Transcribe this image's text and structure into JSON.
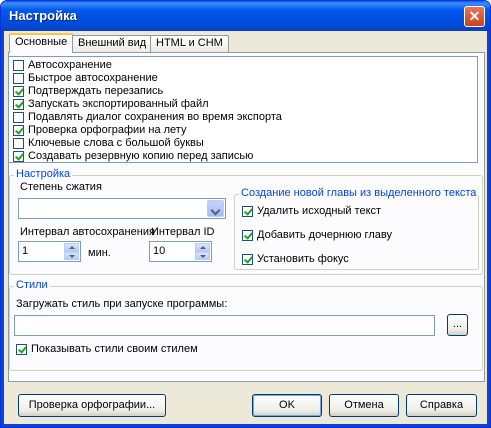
{
  "window": {
    "title": "Настройка",
    "close_glyph": "✕"
  },
  "tabs": [
    {
      "label": "Основные",
      "active": true
    },
    {
      "label": "Внешний вид",
      "active": false
    },
    {
      "label": "HTML и CHM",
      "active": false
    }
  ],
  "options_list": [
    {
      "label": "Автосохранение",
      "checked": false
    },
    {
      "label": "Быстрое автосохранение",
      "checked": false
    },
    {
      "label": "Подтверждать перезапись",
      "checked": true
    },
    {
      "label": "Запускать экспортированный файл",
      "checked": true
    },
    {
      "label": "Подавлять диалог сохранения во время экспорта",
      "checked": false
    },
    {
      "label": "Проверка орфографии на лету",
      "checked": true
    },
    {
      "label": "Ключевые слова с большой буквы",
      "checked": false
    },
    {
      "label": "Создавать резервную копию перед записью",
      "checked": true
    }
  ],
  "settings": {
    "group_title": "Настройка",
    "compression_label": "Степень сжатия",
    "compression_value": "",
    "autosave_interval_label": "Интервал автосохранения",
    "autosave_interval_value": "1",
    "autosave_unit": "мин.",
    "id_interval_label": "Интервал ID",
    "id_interval_value": "10"
  },
  "new_chapter": {
    "group_title": "Создание новой главы из выделенного текста",
    "options": [
      {
        "label": "Удалить исходный текст",
        "checked": true
      },
      {
        "label": "Добавить дочернюю главу",
        "checked": true
      },
      {
        "label": "Установить фокус",
        "checked": true
      }
    ]
  },
  "styles": {
    "group_title": "Стили",
    "load_label": "Загружать стиль при запуске программы:",
    "load_value": "",
    "browse_label": "...",
    "show_styles_label": "Показывать стили своим стилем",
    "show_styles_checked": true
  },
  "footer": {
    "spellcheck_label": "Проверка орфографии...",
    "ok_label": "OK",
    "cancel_label": "Отмена",
    "help_label": "Справка"
  },
  "colors": {
    "titlebar": "#0058ee",
    "dialog_bg": "#ece9d8",
    "group_title": "#0046d5",
    "checkmark": "#21a121"
  }
}
